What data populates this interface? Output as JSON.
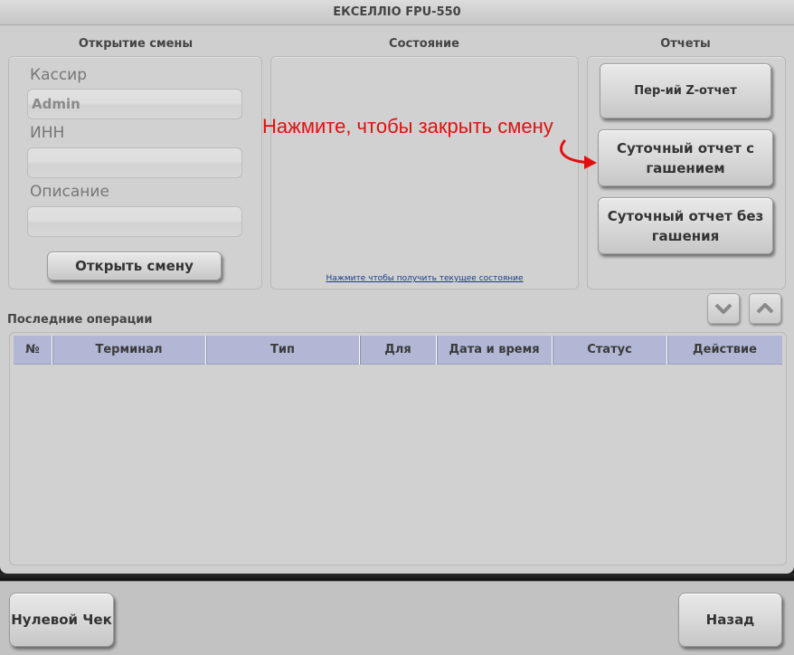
{
  "window": {
    "title": "ЕКСЕЛЛІО FPU-550"
  },
  "open_shift": {
    "title": "Открытие смены",
    "cashier_label": "Кассир",
    "cashier_value": "Admin",
    "inn_label": "ИНН",
    "inn_value": "",
    "description_label": "Описание",
    "description_value": "",
    "open_button": "Открыть смену"
  },
  "status": {
    "title": "Состояние",
    "link": "Нажмите чтобы получить текущее состояние"
  },
  "reports": {
    "title": "Отчеты",
    "periodic_z": "Пер-ий Z-отчет",
    "daily_with_reset_line1": "Суточный отчет с",
    "daily_with_reset_line2": "гашением",
    "daily_without_reset_line1": "Суточный отчет без",
    "daily_without_reset_line2": "гашения"
  },
  "annotation": {
    "text": "Нажмите, чтобы закрыть смену",
    "color": "#e11010"
  },
  "operations": {
    "title": "Последние операции",
    "columns": [
      "№",
      "Терминал",
      "Тип",
      "Для",
      "Дата и время",
      "Статус",
      "Действие"
    ],
    "rows": []
  },
  "footer": {
    "zero_check": "Нулевой Чек",
    "back": "Назад"
  },
  "icons": {
    "scroll_down": "chevron-down-icon",
    "scroll_up": "chevron-up-icon"
  }
}
